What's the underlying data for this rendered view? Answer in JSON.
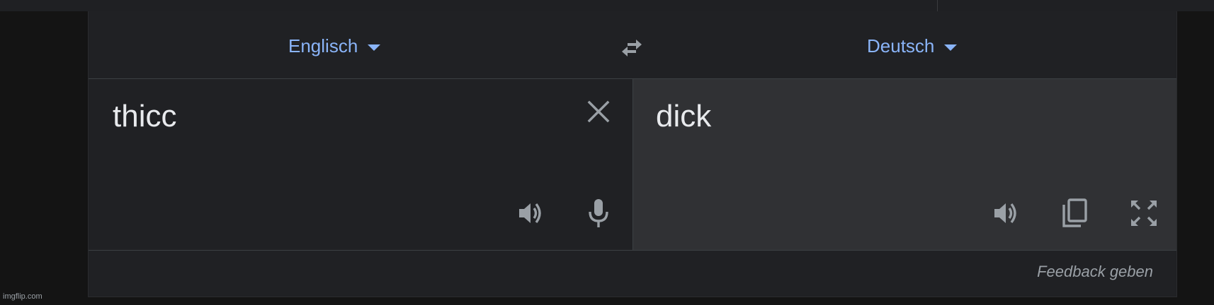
{
  "languages": {
    "source": "Englisch",
    "target": "Deutsch"
  },
  "source": {
    "text": "thicc"
  },
  "target": {
    "text": "dick"
  },
  "footer": {
    "feedback_label": "Feedback geben"
  },
  "watermark": "imgflip.com",
  "colors": {
    "accent": "#8ab4f8",
    "icon": "#9aa0a6",
    "text": "#e8eaed",
    "panel_bg": "#202124",
    "target_bg": "#303134"
  },
  "icons": {
    "swap": "swap-languages-icon",
    "clear": "close-icon",
    "speaker": "speaker-icon",
    "mic": "microphone-icon",
    "copy": "copy-icon",
    "fullscreen": "fullscreen-icon"
  }
}
